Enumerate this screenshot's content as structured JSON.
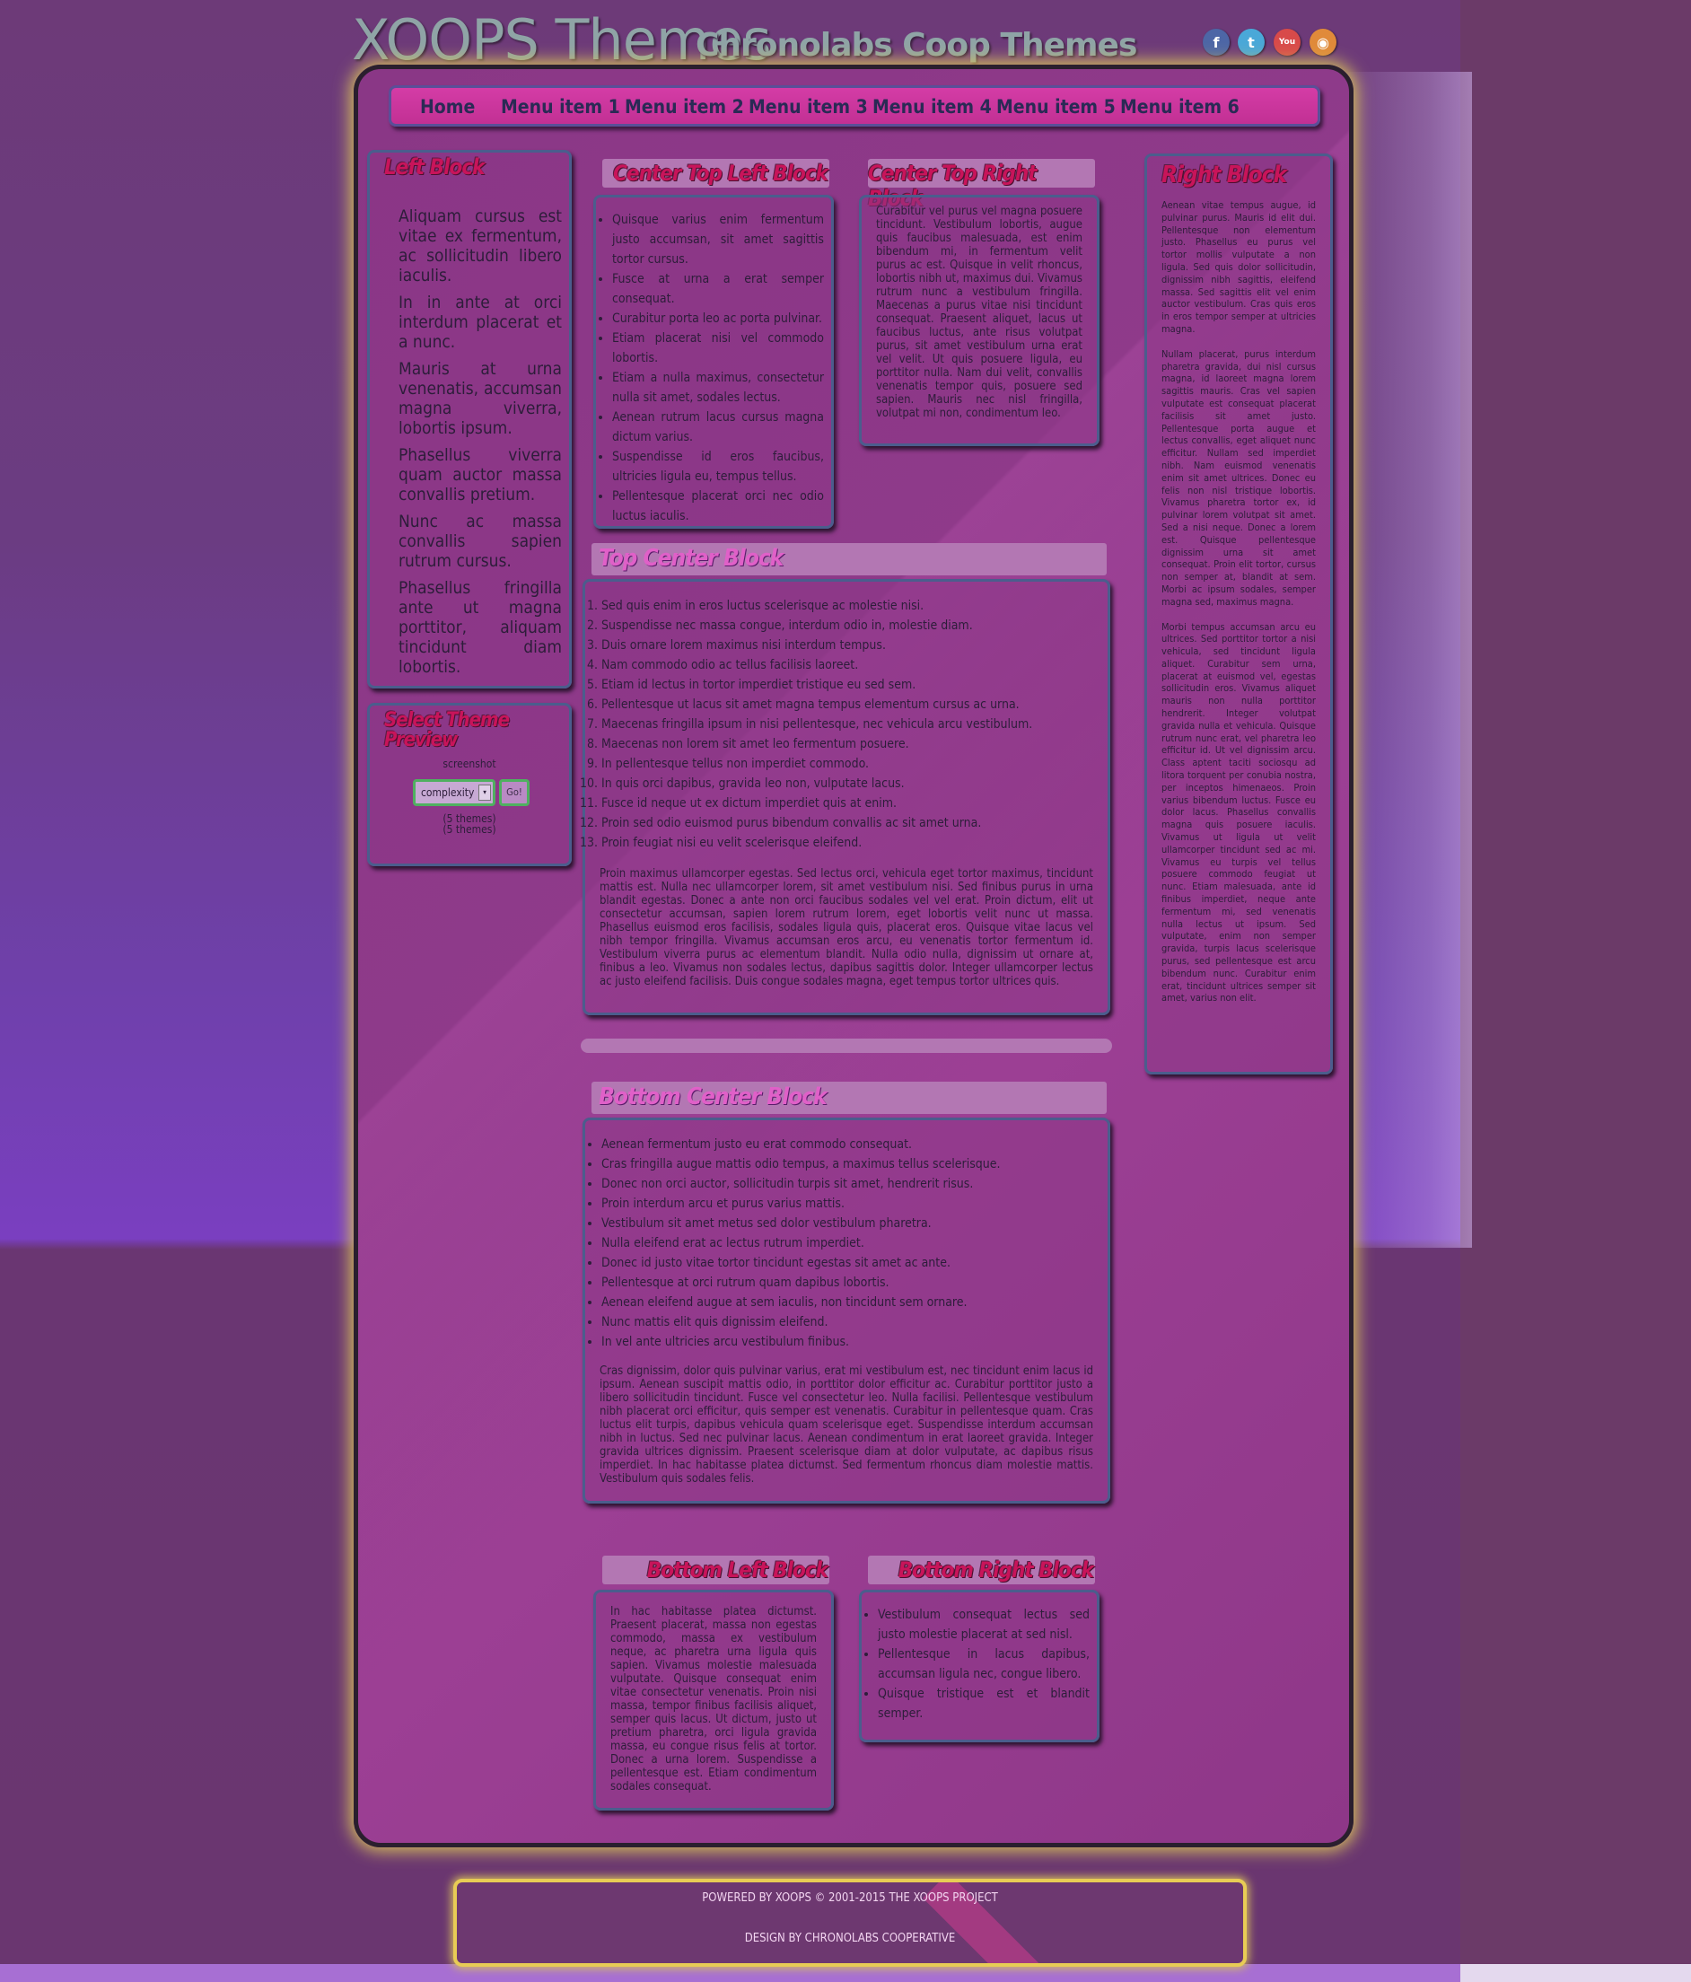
{
  "header": {
    "site_title": "XOOPS Themes",
    "site_slogan": "Chronolabs Coop Themes",
    "social": [
      {
        "icon": "facebook-icon",
        "glyph": "f",
        "color": "#4d66a6"
      },
      {
        "icon": "twitter-icon",
        "glyph": "t",
        "color": "#4aa8d8"
      },
      {
        "icon": "youtube-icon",
        "glyph": "You",
        "color": "#d84a4a"
      },
      {
        "icon": "rss-icon",
        "glyph": "◉",
        "color": "#e08a3a"
      }
    ]
  },
  "menu": {
    "items": [
      "Home",
      "Menu item 1",
      "Menu item 2",
      "Menu item 3",
      "Menu item 4",
      "Menu item 5",
      "Menu item 6"
    ]
  },
  "left_block": {
    "title": "Left Block",
    "paragraphs": [
      "Aliquam cursus est vitae ex fermentum, ac sollicitudin libero iaculis.",
      "In in ante at orci interdum placerat et a nunc.",
      "Mauris at urna venenatis, accumsan magna viverra, lobortis ipsum.",
      "Phasellus viverra quam auctor massa convallis pretium.",
      "Nunc ac massa convallis sapien rutrum cursus.",
      "Phasellus fringilla ante ut magna porttitor, aliquam tincidunt diam lobortis."
    ]
  },
  "theme_block": {
    "title": "Select Theme Preview",
    "screenshot_label": "screenshot",
    "select_value": "complexity",
    "go_label": "Go!",
    "count_1": "(5 themes)",
    "count_2": "(5 themes)"
  },
  "center_top_left": {
    "title": "Center Top Left Block",
    "items": [
      "Quisque varius enim fermentum justo accumsan, sit amet sagittis tortor cursus.",
      "Fusce at urna a erat semper consequat.",
      "Curabitur porta leo ac porta pulvinar.",
      "Etiam placerat nisi vel commodo lobortis.",
      "Etiam a nulla maximus, consectetur nulla sit amet, sodales lectus.",
      "Aenean rutrum lacus cursus magna dictum varius.",
      "Suspendisse id eros faucibus, ultricies ligula eu, tempus tellus.",
      "Pellentesque placerat orci nec odio luctus iaculis."
    ]
  },
  "center_top_right": {
    "title": "Center Top Right Block",
    "text": "Curabitur vel purus vel magna posuere tincidunt. Vestibulum lobortis, augue quis faucibus malesuada, est enim bibendum mi, in fermentum velit purus ac est. Quisque in velit rhoncus, lobortis nibh ut, maximus dui. Vivamus rutrum nunc a vestibulum fringilla. Maecenas a purus vitae nisi tincidunt consequat. Praesent aliquet, lacus ut faucibus luctus, ante risus volutpat purus, sit amet vestibulum urna erat vel velit. Ut quis posuere ligula, eu porttitor nulla. Nam dui velit, convallis venenatis tempor quis, posuere sed sapien. Mauris nec nisl fringilla, volutpat mi non, condimentum leo."
  },
  "top_center": {
    "title": "Top Center Block",
    "items": [
      "Sed quis enim in eros luctus scelerisque ac molestie nisi.",
      "Suspendisse nec massa congue, interdum odio in, molestie diam.",
      "Duis ornare lorem maximus nisi interdum tempus.",
      "Nam commodo odio ac tellus facilisis laoreet.",
      "Etiam id lectus in tortor imperdiet tristique eu sed sem.",
      "Pellentesque ut lacus sit amet magna tempus elementum cursus ac urna.",
      "Maecenas fringilla ipsum in nisi pellentesque, nec vehicula arcu vestibulum.",
      "Maecenas non lorem sit amet leo fermentum posuere.",
      "In pellentesque tellus non imperdiet commodo.",
      "In quis orci dapibus, gravida leo non, vulputate lacus.",
      "Fusce id neque ut ex dictum imperdiet quis at enim.",
      "Proin sed odio euismod purus bibendum convallis ac sit amet urna.",
      "Proin feugiat nisi eu velit scelerisque eleifend."
    ],
    "text": "Proin maximus ullamcorper egestas. Sed lectus orci, vehicula eget tortor maximus, tincidunt mattis est. Nulla nec ullamcorper lorem, sit amet vestibulum nisi. Sed finibus purus in urna blandit egestas. Donec a ante non orci faucibus sodales vel vel erat. Proin dictum, elit ut consectetur accumsan, sapien lorem rutrum lorem, eget lobortis velit nunc ut massa. Phasellus euismod eros facilisis, sodales ligula quis, placerat eros. Quisque vitae lacus vel nibh tempor fringilla. Vivamus accumsan eros arcu, eu venenatis tortor fermentum id. Vestibulum viverra purus ac elementum blandit. Nulla odio nulla, dignissim ut ornare at, finibus a leo. Vivamus non sodales lectus, dapibus sagittis dolor. Integer ullamcorper lectus ac justo eleifend facilisis. Duis congue sodales magna, eget tempus tortor ultrices quis."
  },
  "bottom_center": {
    "title": "Bottom Center Block",
    "items": [
      "Aenean fermentum justo eu erat commodo consequat.",
      "Cras fringilla augue mattis odio tempus, a maximus tellus scelerisque.",
      "Donec non orci auctor, sollicitudin turpis sit amet, hendrerit risus.",
      "Proin interdum arcu et purus varius mattis.",
      "Vestibulum sit amet metus sed dolor vestibulum pharetra.",
      "Nulla eleifend erat ac lectus rutrum imperdiet.",
      "Donec id justo vitae tortor tincidunt egestas sit amet ac ante.",
      "Pellentesque at orci rutrum quam dapibus lobortis.",
      "Aenean eleifend augue at sem iaculis, non tincidunt sem ornare.",
      "Nunc mattis elit quis dignissim eleifend.",
      "In vel ante ultricies arcu vestibulum finibus."
    ],
    "text": "Cras dignissim, dolor quis pulvinar varius, erat mi vestibulum est, nec tincidunt enim lacus id ipsum. Aenean suscipit mattis odio, in porttitor dolor efficitur ac. Curabitur porttitor justo a libero sollicitudin tincidunt. Fusce vel consectetur leo. Nulla facilisi. Pellentesque vestibulum nibh placerat orci efficitur, quis semper est venenatis. Curabitur in pellentesque quam. Cras luctus elit turpis, dapibus vehicula quam scelerisque eget. Suspendisse interdum accumsan nibh in luctus. Sed nec pulvinar lacus. Aenean condimentum in erat laoreet gravida. Integer gravida ultrices dignissim. Praesent scelerisque diam at dolor vulputate, ac dapibus risus imperdiet. In hac habitasse platea dictumst. Sed fermentum rhoncus diam molestie mattis. Vestibulum quis sodales felis."
  },
  "bottom_left": {
    "title": "Bottom Left Block",
    "text": "In hac habitasse platea dictumst. Praesent placerat, massa non egestas commodo, massa ex vestibulum neque, ac pharetra urna ligula quis sapien. Vivamus molestie malesuada vulputate. Quisque consequat enim vitae consectetur venenatis. Proin nisi massa, tempor finibus facilisis aliquet, semper quis lacus. Ut dictum, justo ut pretium pharetra, orci ligula gravida massa, eu congue risus felis at tortor. Donec a urna lorem. Suspendisse a pellentesque est. Etiam condimentum sodales consequat."
  },
  "bottom_right": {
    "title": "Bottom Right Block",
    "items": [
      "Vestibulum consequat lectus sed justo molestie placerat at sed nisl.",
      "Pellentesque in lacus dapibus, accumsan ligula nec, congue libero.",
      "Quisque tristique est et blandit semper."
    ]
  },
  "right_block": {
    "title": "Right Block",
    "paragraphs": [
      "Aenean vitae tempus augue, id pulvinar purus. Mauris id elit dui. Pellentesque non elementum justo. Phasellus eu purus vel tortor mollis vulputate a non ligula. Sed quis dolor sollicitudin, dignissim nibh sagittis, eleifend massa. Sed sagittis elit vel enim auctor vestibulum. Cras quis eros in eros tempor semper at ultricies magna.",
      "Nullam placerat, purus interdum pharetra gravida, dui nisl cursus magna, id laoreet magna lorem sagittis mauris. Cras vel sapien vulputate est consequat placerat facilisis sit amet justo. Pellentesque porta augue et lectus convallis, eget aliquet nunc efficitur. Nullam sed imperdiet nibh. Nam euismod venenatis enim sit amet ultrices. Donec eu felis non nisl tristique lobortis. Vivamus pharetra tortor ex, id pulvinar lorem volutpat sit amet. Sed a nisi neque. Donec a lorem est. Quisque pellentesque dignissim urna sit amet consequat. Proin elit tortor, cursus non semper at, blandit at sem. Morbi ac ipsum sodales, semper magna sed, maximus magna.",
      "Morbi tempus accumsan arcu eu ultrices. Sed porttitor tortor a nisi vehicula, sed tincidunt ligula aliquet. Curabitur sem urna, placerat at euismod vel, egestas sollicitudin eros. Vivamus aliquet mauris non nulla porttitor hendrerit. Integer volutpat gravida nulla et vehicula. Quisque rutrum nunc erat, vel pharetra leo efficitur id. Ut vel dignissim arcu. Class aptent taciti sociosqu ad litora torquent per conubia nostra, per inceptos himenaeos. Proin varius bibendum luctus. Fusce eu dolor lacus. Phasellus convallis magna quis posuere iaculis. Vivamus ut ligula ut velit ullamcorper tincidunt sed ac mi. Vivamus eu turpis vel tellus posuere commodo feugiat ut nunc. Etiam malesuada, ante id finibus imperdiet, neque ante fermentum mi, sed venenatis nulla lectus ut ipsum. Sed vulputate, enim non semper gravida, turpis lacus scelerisque purus, sed pellentesque est arcu bibendum nunc. Curabitur enim erat, tincidunt ultrices semper sit amet, varius non elit."
    ]
  },
  "footer": {
    "powered": "POWERED BY XOOPS © 2001-2015 THE XOOPS PROJECT",
    "design": "DESIGN BY CHRONOLABS COOPERATIVE"
  }
}
